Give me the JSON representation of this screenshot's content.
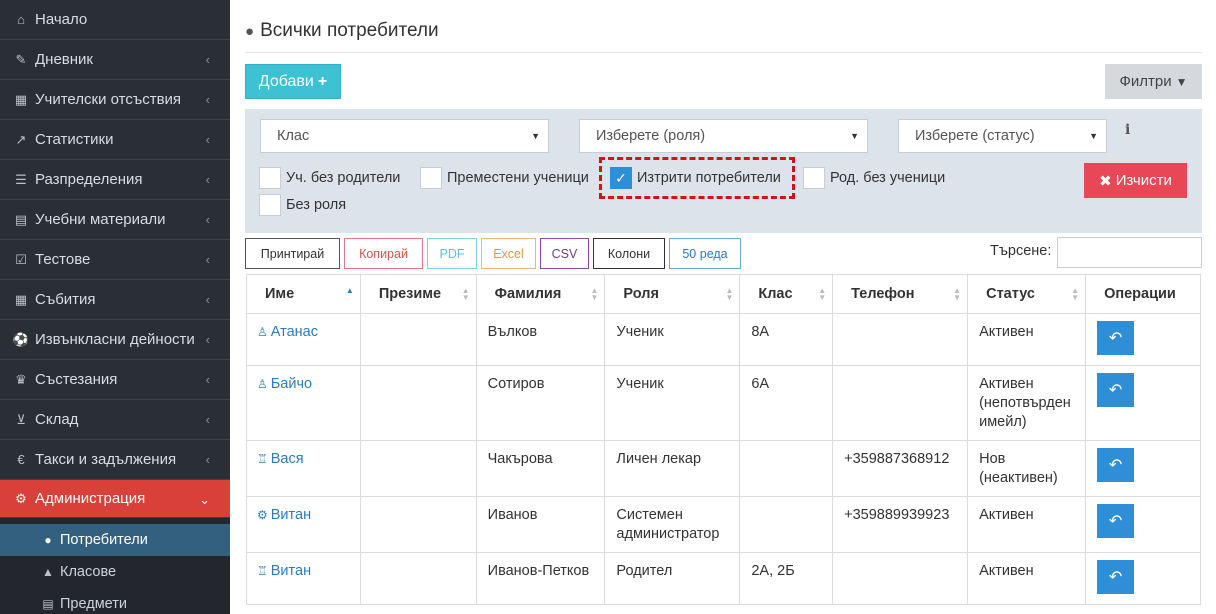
{
  "sidebar": {
    "items": [
      {
        "label": "Начало",
        "icon": "home-icon",
        "glyph": "⌂",
        "chevron": false
      },
      {
        "label": "Дневник",
        "icon": "edit-icon",
        "glyph": "✎",
        "chevron": true
      },
      {
        "label": "Учителски отсъствия",
        "icon": "calendar-x-icon",
        "glyph": "▦",
        "chevron": true
      },
      {
        "label": "Статистики",
        "icon": "line-chart-icon",
        "glyph": "↗",
        "chevron": true
      },
      {
        "label": "Разпределения",
        "icon": "list-icon",
        "glyph": "☰",
        "chevron": true
      },
      {
        "label": "Учебни материали",
        "icon": "book-icon",
        "glyph": "▤",
        "chevron": true
      },
      {
        "label": "Тестове",
        "icon": "check-square-icon",
        "glyph": "☑",
        "chevron": true
      },
      {
        "label": "Събития",
        "icon": "calendar-icon",
        "glyph": "▦",
        "chevron": true
      },
      {
        "label": "Извънкласни дейности",
        "icon": "soccer-ball-icon",
        "glyph": "⚽",
        "chevron": true
      },
      {
        "label": "Състезания",
        "icon": "trophy-icon",
        "glyph": "♛",
        "chevron": true
      },
      {
        "label": "Склад",
        "icon": "cart-icon",
        "glyph": "⊻",
        "chevron": true
      },
      {
        "label": "Такси и задължения",
        "icon": "euro-icon",
        "glyph": "€",
        "chevron": true
      },
      {
        "label": "Администрация",
        "icon": "cogs-icon",
        "glyph": "⚙",
        "chevron": true,
        "expanded": true
      }
    ],
    "subitems": [
      {
        "label": "Потребители",
        "icon": "user-icon",
        "glyph": "●",
        "active": true
      },
      {
        "label": "Класове",
        "icon": "graduation-cap-icon",
        "glyph": "▲",
        "active": false
      },
      {
        "label": "Предмети",
        "icon": "book-icon",
        "glyph": "▤",
        "active": false
      }
    ]
  },
  "header": {
    "title": "Всички потребители",
    "title_icon": "user-icon"
  },
  "toolbar": {
    "add_label": "Добави",
    "filters_label": "Филтри"
  },
  "filters": {
    "class_select": "Клас",
    "role_select": "Изберете (роля)",
    "status_select": "Изберете (статус)",
    "checkboxes": [
      {
        "label": "Уч. без родители",
        "checked": false
      },
      {
        "label": "Преместени ученици",
        "checked": false
      },
      {
        "label": "Изтрити потребители",
        "checked": true
      },
      {
        "label": "Род. без ученици",
        "checked": false
      },
      {
        "label": "Без роля",
        "checked": false
      }
    ],
    "clear_label": "Изчисти"
  },
  "table_tools": {
    "print": "Принтирай",
    "copy": "Копирай",
    "pdf": "PDF",
    "excel": "Excel",
    "csv": "CSV",
    "columns": "Колони",
    "rows": "50 реда",
    "search_label": "Търсене:",
    "search_value": ""
  },
  "table": {
    "columns": [
      "Име",
      "Презиме",
      "Фамилия",
      "Роля",
      "Клас",
      "Телефон",
      "Статус",
      "Операции"
    ],
    "rows": [
      {
        "icon": "student-icon",
        "glyph": "♙",
        "name": "Атанас",
        "middle": "",
        "last": "Вълков",
        "role": "Ученик",
        "class": "8А",
        "phone": "",
        "status": "Активен"
      },
      {
        "icon": "student-icon",
        "glyph": "♙",
        "name": "Байчо",
        "middle": "",
        "last": "Сотиров",
        "role": "Ученик",
        "class": "6А",
        "phone": "",
        "status": "Активен (непотвърден имейл)"
      },
      {
        "icon": "doctor-icon",
        "glyph": "♖",
        "name": "Вася",
        "middle": "",
        "last": "Чакърова",
        "role": "Личен лекар",
        "class": "",
        "phone": "+359887368912",
        "status": "Нов (неактивен)"
      },
      {
        "icon": "gear-icon",
        "glyph": "⚙",
        "name": "Витан",
        "middle": "",
        "last": "Иванов",
        "role": "Системен администратор",
        "class": "",
        "phone": "+359889939923",
        "status": "Активен"
      },
      {
        "icon": "parent-icon",
        "glyph": "♖",
        "name": "Витан",
        "middle": "",
        "last": "Иванов-Петков",
        "role": "Родител",
        "class": "2А, 2Б",
        "phone": "",
        "status": "Активен"
      }
    ]
  },
  "colors": {
    "add": "#3cc2d3",
    "clear": "#e84855",
    "active_nav": "#d9403a",
    "link": "#2a7bbf",
    "op_button": "#2f8fd6"
  }
}
